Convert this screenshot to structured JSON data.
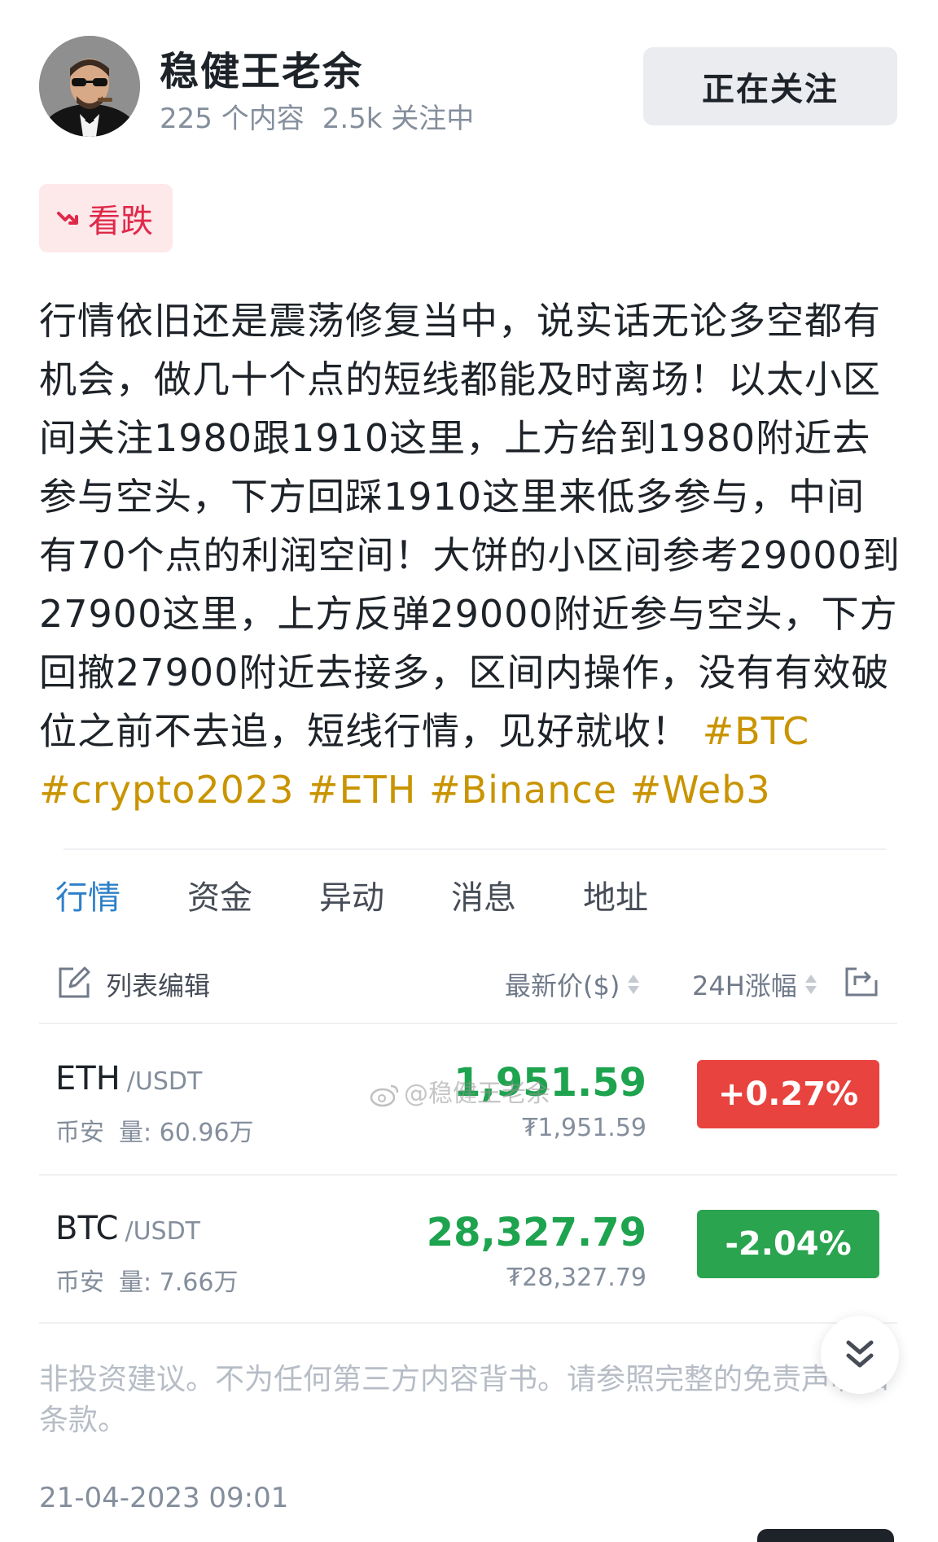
{
  "author": {
    "name": "稳健王老余",
    "posts": "225 个内容",
    "following": "2.5k 关注中",
    "follow_button": "正在关注"
  },
  "sentiment": {
    "label": "看跌",
    "color": "#e0294a"
  },
  "post": {
    "text": "行情依旧还是震荡修复当中，说实话无论多空都有机会，做几十个点的短线都能及时离场！以太小区间关注1980跟1910这里，上方给到1980附近去参与空头，下方回踩1910这里来低多参与，中间有70个点的利润空间！大饼的小区间参考29000到27900这里，上方反弹29000附近参与空头，下方回撤27900附近去接多，区间内操作，没有有效破位之前不去追，短线行情，见好就收！",
    "hashtags": [
      "#BTC",
      "#crypto2023",
      "#ETH",
      "#Binance",
      "#Web3"
    ]
  },
  "market": {
    "tabs": [
      "行情",
      "资金",
      "异动",
      "消息",
      "地址"
    ],
    "active_tab": "行情",
    "edit_label": "列表编辑",
    "price_header": "最新价($)",
    "change_header": "24H涨幅",
    "tickers": [
      {
        "symbol": "ETH",
        "quote": "/USDT",
        "exchange": "币安",
        "volume": "量: 60.96万",
        "price": "1,951.59",
        "fiat_price": "₮1,951.59",
        "change": "+0.27%",
        "change_color": "#e8433e"
      },
      {
        "symbol": "BTC",
        "quote": "/USDT",
        "exchange": "币安",
        "volume": "量: 7.66万",
        "price": "28,327.79",
        "fiat_price": "₮28,327.79",
        "change": "-2.04%",
        "change_color": "#2aa44f"
      }
    ]
  },
  "watermark": "@稳健王老余",
  "disclaimer": "非投资建议。不为任何第三方内容背书。请参照完整的免责声明和条款。",
  "timestamp": "21-04-2023 09:01",
  "colors": {
    "hashtag": "#c99400",
    "tab_active": "#2d80c8",
    "price_green": "#1ea34f"
  }
}
